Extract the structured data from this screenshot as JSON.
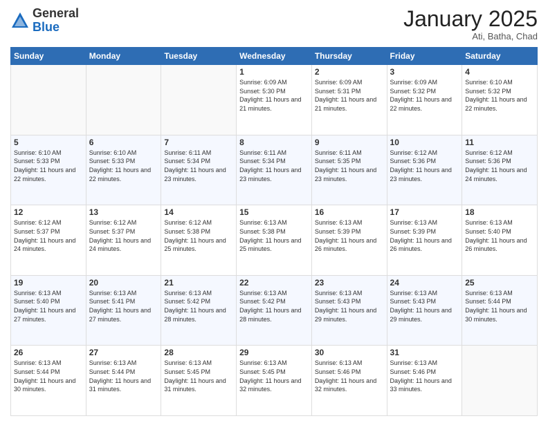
{
  "logo": {
    "general": "General",
    "blue": "Blue"
  },
  "header": {
    "month": "January 2025",
    "location": "Ati, Batha, Chad"
  },
  "days_of_week": [
    "Sunday",
    "Monday",
    "Tuesday",
    "Wednesday",
    "Thursday",
    "Friday",
    "Saturday"
  ],
  "weeks": [
    [
      {
        "day": "",
        "info": ""
      },
      {
        "day": "",
        "info": ""
      },
      {
        "day": "",
        "info": ""
      },
      {
        "day": "1",
        "info": "Sunrise: 6:09 AM\nSunset: 5:30 PM\nDaylight: 11 hours and 21 minutes."
      },
      {
        "day": "2",
        "info": "Sunrise: 6:09 AM\nSunset: 5:31 PM\nDaylight: 11 hours and 21 minutes."
      },
      {
        "day": "3",
        "info": "Sunrise: 6:09 AM\nSunset: 5:32 PM\nDaylight: 11 hours and 22 minutes."
      },
      {
        "day": "4",
        "info": "Sunrise: 6:10 AM\nSunset: 5:32 PM\nDaylight: 11 hours and 22 minutes."
      }
    ],
    [
      {
        "day": "5",
        "info": "Sunrise: 6:10 AM\nSunset: 5:33 PM\nDaylight: 11 hours and 22 minutes."
      },
      {
        "day": "6",
        "info": "Sunrise: 6:10 AM\nSunset: 5:33 PM\nDaylight: 11 hours and 22 minutes."
      },
      {
        "day": "7",
        "info": "Sunrise: 6:11 AM\nSunset: 5:34 PM\nDaylight: 11 hours and 23 minutes."
      },
      {
        "day": "8",
        "info": "Sunrise: 6:11 AM\nSunset: 5:34 PM\nDaylight: 11 hours and 23 minutes."
      },
      {
        "day": "9",
        "info": "Sunrise: 6:11 AM\nSunset: 5:35 PM\nDaylight: 11 hours and 23 minutes."
      },
      {
        "day": "10",
        "info": "Sunrise: 6:12 AM\nSunset: 5:36 PM\nDaylight: 11 hours and 23 minutes."
      },
      {
        "day": "11",
        "info": "Sunrise: 6:12 AM\nSunset: 5:36 PM\nDaylight: 11 hours and 24 minutes."
      }
    ],
    [
      {
        "day": "12",
        "info": "Sunrise: 6:12 AM\nSunset: 5:37 PM\nDaylight: 11 hours and 24 minutes."
      },
      {
        "day": "13",
        "info": "Sunrise: 6:12 AM\nSunset: 5:37 PM\nDaylight: 11 hours and 24 minutes."
      },
      {
        "day": "14",
        "info": "Sunrise: 6:12 AM\nSunset: 5:38 PM\nDaylight: 11 hours and 25 minutes."
      },
      {
        "day": "15",
        "info": "Sunrise: 6:13 AM\nSunset: 5:38 PM\nDaylight: 11 hours and 25 minutes."
      },
      {
        "day": "16",
        "info": "Sunrise: 6:13 AM\nSunset: 5:39 PM\nDaylight: 11 hours and 26 minutes."
      },
      {
        "day": "17",
        "info": "Sunrise: 6:13 AM\nSunset: 5:39 PM\nDaylight: 11 hours and 26 minutes."
      },
      {
        "day": "18",
        "info": "Sunrise: 6:13 AM\nSunset: 5:40 PM\nDaylight: 11 hours and 26 minutes."
      }
    ],
    [
      {
        "day": "19",
        "info": "Sunrise: 6:13 AM\nSunset: 5:40 PM\nDaylight: 11 hours and 27 minutes."
      },
      {
        "day": "20",
        "info": "Sunrise: 6:13 AM\nSunset: 5:41 PM\nDaylight: 11 hours and 27 minutes."
      },
      {
        "day": "21",
        "info": "Sunrise: 6:13 AM\nSunset: 5:42 PM\nDaylight: 11 hours and 28 minutes."
      },
      {
        "day": "22",
        "info": "Sunrise: 6:13 AM\nSunset: 5:42 PM\nDaylight: 11 hours and 28 minutes."
      },
      {
        "day": "23",
        "info": "Sunrise: 6:13 AM\nSunset: 5:43 PM\nDaylight: 11 hours and 29 minutes."
      },
      {
        "day": "24",
        "info": "Sunrise: 6:13 AM\nSunset: 5:43 PM\nDaylight: 11 hours and 29 minutes."
      },
      {
        "day": "25",
        "info": "Sunrise: 6:13 AM\nSunset: 5:44 PM\nDaylight: 11 hours and 30 minutes."
      }
    ],
    [
      {
        "day": "26",
        "info": "Sunrise: 6:13 AM\nSunset: 5:44 PM\nDaylight: 11 hours and 30 minutes."
      },
      {
        "day": "27",
        "info": "Sunrise: 6:13 AM\nSunset: 5:44 PM\nDaylight: 11 hours and 31 minutes."
      },
      {
        "day": "28",
        "info": "Sunrise: 6:13 AM\nSunset: 5:45 PM\nDaylight: 11 hours and 31 minutes."
      },
      {
        "day": "29",
        "info": "Sunrise: 6:13 AM\nSunset: 5:45 PM\nDaylight: 11 hours and 32 minutes."
      },
      {
        "day": "30",
        "info": "Sunrise: 6:13 AM\nSunset: 5:46 PM\nDaylight: 11 hours and 32 minutes."
      },
      {
        "day": "31",
        "info": "Sunrise: 6:13 AM\nSunset: 5:46 PM\nDaylight: 11 hours and 33 minutes."
      },
      {
        "day": "",
        "info": ""
      }
    ]
  ]
}
